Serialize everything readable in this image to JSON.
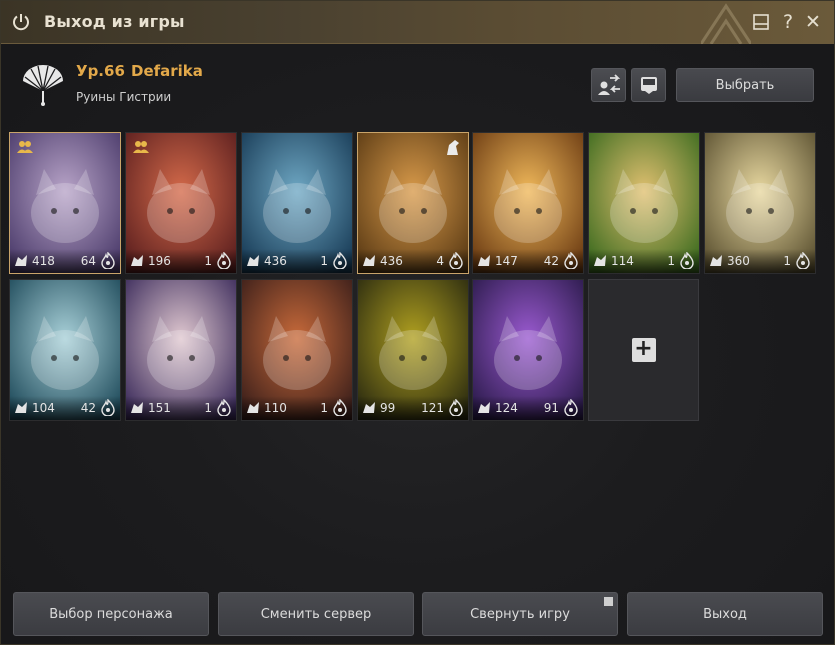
{
  "window": {
    "title": "Выход из игры"
  },
  "titlebar_buttons": [
    {
      "name": "window-toggle-icon",
      "glyph": "▭"
    },
    {
      "name": "help-icon",
      "glyph": "?"
    },
    {
      "name": "close-icon",
      "glyph": "✕"
    }
  ],
  "character": {
    "level": "Ур.66",
    "name": "Defarika",
    "location": "Руины Гистрии"
  },
  "header_buttons": {
    "choose_label": "Выбрать"
  },
  "cards": [
    {
      "v1": "418",
      "v2": "64",
      "badge": true,
      "selected": true,
      "c1": "#4a3a6a",
      "c2": "#b8a4c8"
    },
    {
      "v1": "196",
      "v2": "1",
      "badge": true,
      "selected": false,
      "c1": "#5a1e1e",
      "c2": "#d46a4a"
    },
    {
      "v1": "436",
      "v2": "1",
      "badge": false,
      "selected": false,
      "c1": "#173a55",
      "c2": "#6fa8c4"
    },
    {
      "v1": "436",
      "v2": "4",
      "badge": false,
      "selected": true,
      "corner": true,
      "c1": "#5a3a14",
      "c2": "#d89a4a"
    },
    {
      "v1": "147",
      "v2": "42",
      "badge": false,
      "selected": false,
      "c1": "#6a3a12",
      "c2": "#f0b85a"
    },
    {
      "v1": "114",
      "v2": "1",
      "badge": false,
      "selected": false,
      "c1": "#3a6a1e",
      "c2": "#e0c070"
    },
    {
      "v1": "360",
      "v2": "1",
      "badge": false,
      "selected": false,
      "c1": "#5a5030",
      "c2": "#e8d8a0"
    },
    {
      "v1": "104",
      "v2": "42",
      "badge": false,
      "selected": false,
      "c1": "#1e4a5a",
      "c2": "#a8d0d8"
    },
    {
      "v1": "151",
      "v2": "1",
      "badge": false,
      "selected": false,
      "c1": "#3a2a5a",
      "c2": "#e0c8d0"
    },
    {
      "v1": "110",
      "v2": "1",
      "badge": false,
      "selected": false,
      "c1": "#3a1e1a",
      "c2": "#c86a3a"
    },
    {
      "v1": "99",
      "v2": "121",
      "badge": false,
      "selected": false,
      "c1": "#2a2a10",
      "c2": "#b0a020"
    },
    {
      "v1": "124",
      "v2": "91",
      "badge": false,
      "selected": false,
      "c1": "#2a1a4a",
      "c2": "#9a5ad0"
    }
  ],
  "bottom_buttons": {
    "select_char": "Выбор персонажа",
    "change_server": "Сменить сервер",
    "minimize_game": "Свернуть игру",
    "exit": "Выход"
  }
}
